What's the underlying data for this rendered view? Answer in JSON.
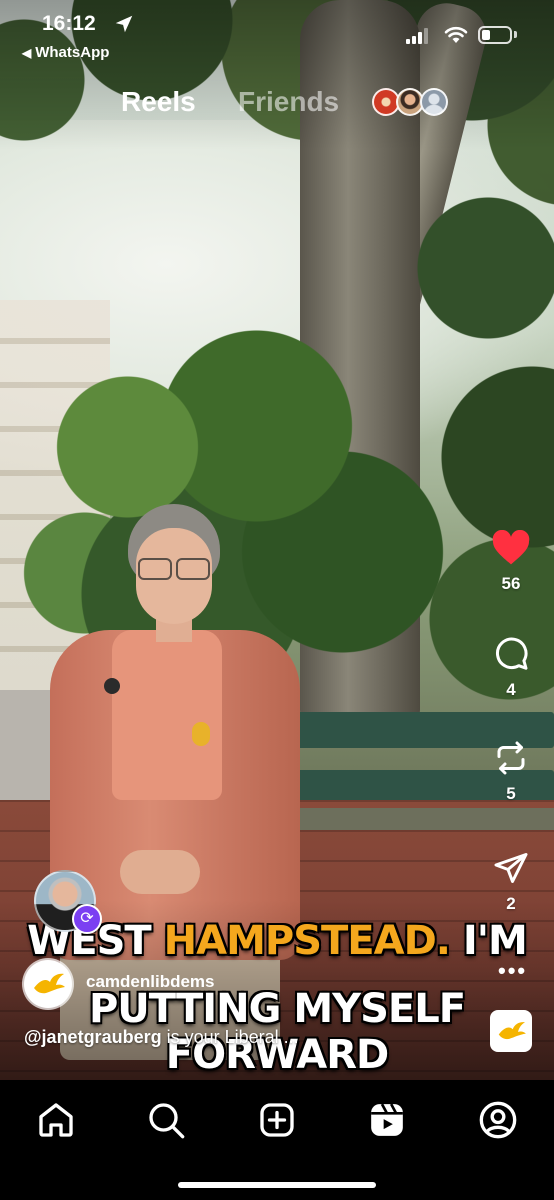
{
  "status_bar": {
    "time": "16:12",
    "back_app": "WhatsApp",
    "battery_level": 0.3
  },
  "header": {
    "tabs": [
      {
        "label": "Reels",
        "active": true
      },
      {
        "label": "Friends",
        "active": false
      }
    ]
  },
  "actions": {
    "likes": "56",
    "comments": "4",
    "reposts": "5",
    "shares": "2"
  },
  "video_caption": {
    "line1_plain": "WEST",
    "line1_highlight": "HAMPSTEAD.",
    "line1_tail": "I'M",
    "line2": "PUTTING MYSELF FORWARD"
  },
  "author": {
    "username": "camdenlibdems"
  },
  "post_caption": {
    "mention": "@janetgrauberg",
    "text": " is your Liberal ..."
  },
  "colors": {
    "like_red": "#ff3040",
    "caption_highlight": "#f4a71d",
    "remix_purple": "#7b3ff2",
    "libdem_gold": "#f5b400"
  },
  "bottom_nav": {
    "items": [
      "home-icon",
      "search-icon",
      "create-icon",
      "reels-icon",
      "profile-icon"
    ]
  }
}
